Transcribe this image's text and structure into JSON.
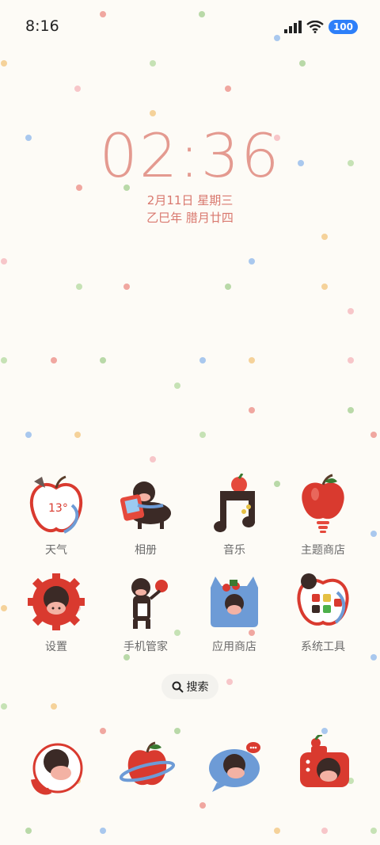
{
  "status_bar": {
    "time": "8:16",
    "battery": "100"
  },
  "clock": {
    "time": "02:36",
    "date": "2月11日 星期三",
    "lunar": "乙巳年 腊月廿四"
  },
  "apps": [
    {
      "label": "天气",
      "icon": "weather-apple-icon",
      "temp": "13°"
    },
    {
      "label": "相册",
      "icon": "gallery-pony-icon"
    },
    {
      "label": "音乐",
      "icon": "music-note-icon"
    },
    {
      "label": "主题商店",
      "icon": "theme-apple-icon"
    },
    {
      "label": "设置",
      "icon": "settings-gear-icon"
    },
    {
      "label": "手机管家",
      "icon": "phone-manager-icon"
    },
    {
      "label": "应用商店",
      "icon": "app-store-bag-icon"
    },
    {
      "label": "系统工具",
      "icon": "system-tools-icon"
    }
  ],
  "search": {
    "label": "搜索"
  },
  "dock": [
    {
      "icon": "phone-pony-icon"
    },
    {
      "icon": "browser-planet-icon"
    },
    {
      "icon": "messages-bubble-icon"
    },
    {
      "icon": "camera-apple-icon"
    }
  ],
  "colors": {
    "background": "#fdfbf6",
    "clock": "#e49a90",
    "apple_red": "#d93a2f",
    "accent_blue": "#6d9bd6"
  }
}
